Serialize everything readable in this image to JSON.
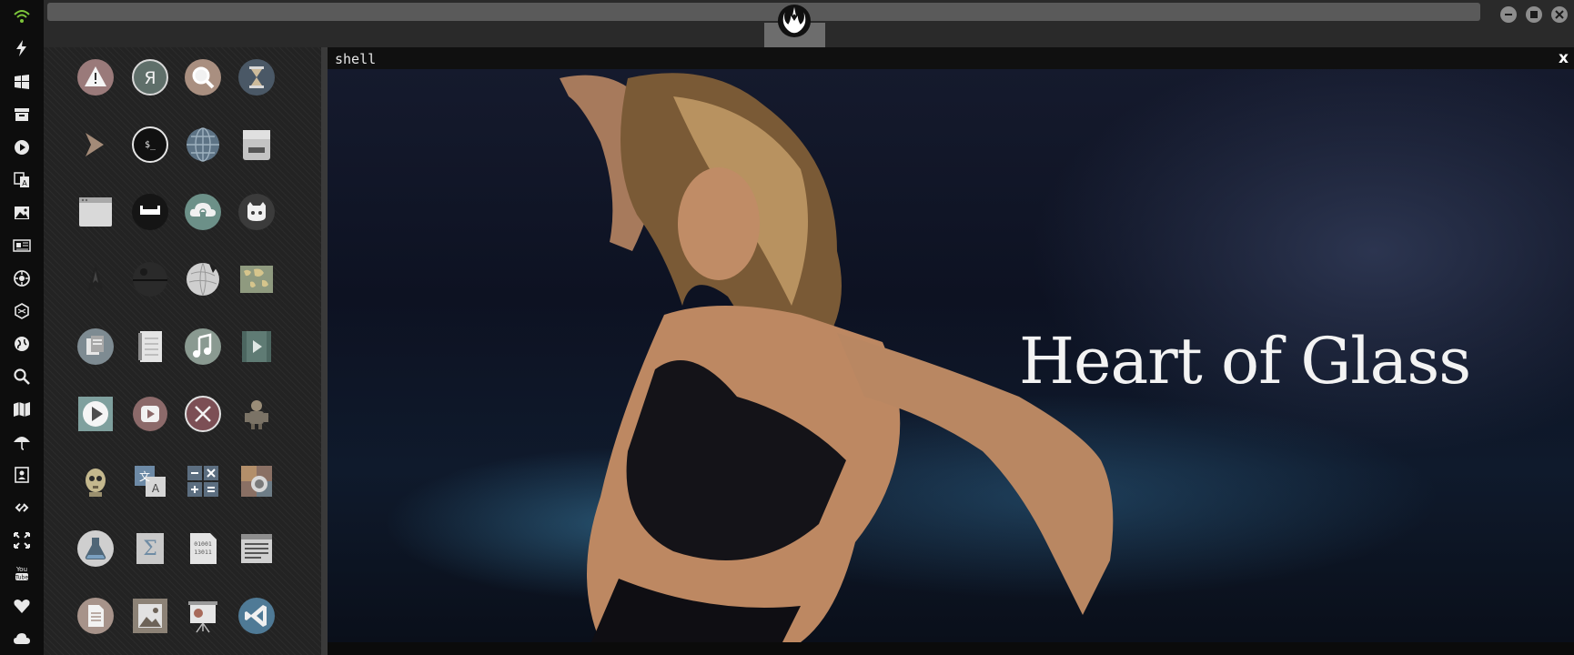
{
  "window": {
    "shell_title": "shell",
    "shell_close": "x"
  },
  "video": {
    "title": "Heart of Glass"
  },
  "dock": {
    "icons": [
      "wifi-icon",
      "lightning-icon",
      "windows-icon",
      "archive-icon",
      "play-circle-icon",
      "translate-icon",
      "image-icon",
      "news-icon",
      "settings-badge-icon",
      "hexagon-icon",
      "globe-icon",
      "search-icon",
      "map-icon",
      "umbrella-icon",
      "contacts-icon",
      "link-icon",
      "fullscreen-icon",
      "youtube-icon",
      "heart-icon",
      "cloud-icon"
    ],
    "youtube_label": "You\nTube"
  },
  "apps": {
    "icons": [
      "warning-icon",
      "yandex-icon",
      "search-icon",
      "hourglass-icon",
      "terminal-prompt-icon",
      "terminal-icon",
      "globe-icon",
      "drive-icon",
      "window-icon",
      "cinema-icon",
      "cloud-lock-icon",
      "github-icon",
      "star-trek-icon",
      "death-star-icon",
      "wikipedia-icon",
      "world-map-icon",
      "files-icon",
      "notebook-icon",
      "music-icon",
      "video-icon",
      "play-icon",
      "youtube-play-icon",
      "close-circle-icon",
      "robot-icon",
      "c3po-icon",
      "translate-icon",
      "calculator-icon",
      "camera-icon",
      "lab-flask-icon",
      "sigma-icon",
      "binary-file-icon",
      "text-editor-icon",
      "document-icon",
      "image-viewer-icon",
      "presentation-icon",
      "vscode-icon"
    ],
    "yandex_letter": "Я",
    "terminal_symbol": "$_",
    "binary_text_1": "01001",
    "binary_text_2": "13011"
  },
  "colors": {
    "dock_bg": "#0d0d0d",
    "wifi_green": "#7cc43a",
    "topbar_bg": "#2a2a2a",
    "apps_bg": "#262626",
    "video_bg": "#11162a"
  }
}
